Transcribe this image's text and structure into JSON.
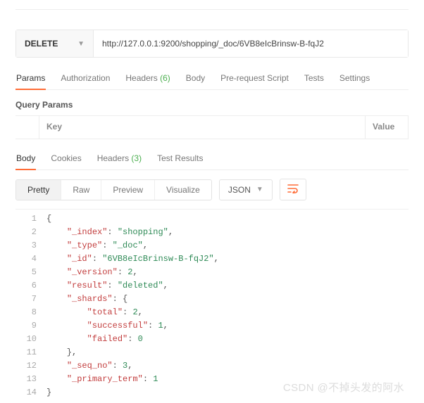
{
  "request": {
    "method": "DELETE",
    "url": "http://127.0.0.1:9200/shopping/_doc/6VB8eIcBrinsw-B-fqJ2"
  },
  "tabs": {
    "params": "Params",
    "auth": "Authorization",
    "headers": "Headers",
    "headers_count": "(6)",
    "body": "Body",
    "prereq": "Pre-request Script",
    "tests": "Tests",
    "settings": "Settings"
  },
  "qp": {
    "title": "Query Params",
    "key": "Key",
    "value": "Value"
  },
  "resp_tabs": {
    "body": "Body",
    "cookies": "Cookies",
    "headers": "Headers",
    "headers_count": "(3)",
    "tests": "Test Results"
  },
  "ctrl": {
    "pretty": "Pretty",
    "raw": "Raw",
    "preview": "Preview",
    "visualize": "Visualize",
    "fmt": "JSON"
  },
  "code": [
    [
      1,
      "{"
    ],
    [
      2,
      "    <k>\"_index\"</k>: <s>\"shopping\"</s>,"
    ],
    [
      3,
      "    <k>\"_type\"</k>: <s>\"_doc\"</s>,"
    ],
    [
      4,
      "    <k>\"_id\"</k>: <s>\"6VB8eIcBrinsw-B-fqJ2\"</s>,"
    ],
    [
      5,
      "    <k>\"_version\"</k>: <n>2</n>,"
    ],
    [
      6,
      "    <k>\"result\"</k>: <s>\"deleted\"</s>,"
    ],
    [
      7,
      "    <k>\"_shards\"</k>: {"
    ],
    [
      8,
      "        <k>\"total\"</k>: <n>2</n>,"
    ],
    [
      9,
      "        <k>\"successful\"</k>: <n>1</n>,"
    ],
    [
      10,
      "        <k>\"failed\"</k>: <n>0</n>"
    ],
    [
      11,
      "    },"
    ],
    [
      12,
      "    <k>\"_seq_no\"</k>: <n>3</n>,"
    ],
    [
      13,
      "    <k>\"_primary_term\"</k>: <n>1</n>"
    ],
    [
      14,
      "}"
    ]
  ],
  "watermark": "CSDN @不掉头发的阿水"
}
